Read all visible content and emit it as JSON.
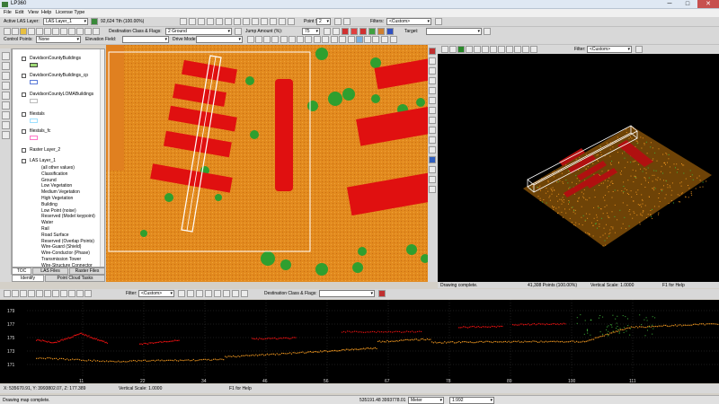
{
  "window": {
    "title": "LP360",
    "min": "─",
    "max": "□",
    "close": "✕"
  },
  "menu": [
    "File",
    "Edit",
    "View",
    "Help",
    "License Type"
  ],
  "toolbar1": {
    "active_las_label": "Active LAS Layer:",
    "active_las_value": "LAS Layer_1",
    "points_pct": "92,624 Tth (100.00%)",
    "point_size_label": "Point Size:",
    "point_size_value": "2",
    "filters_label": "Filters:",
    "filters_value": "<Custom>"
  },
  "toolbar2": {
    "dest_class_label": "Destination Class & Flags:",
    "dest_class_value": "2  Ground",
    "jump_amount_label": "Jump Amount (%):",
    "jump_amount_value": "75",
    "target_label": "Target:"
  },
  "toolbar3": {
    "control_points_label": "Control Points:",
    "control_points_value": "None",
    "elevation_field_label": "Elevation Field:",
    "drive_mode_label": "Drive Mode:"
  },
  "toc": {
    "layers": [
      {
        "label": "DavidsonCountyBuildings",
        "color": "#9fd977"
      },
      {
        "label": "DavidsonCountyBuildings_cp",
        "color": "#5a7ad8"
      },
      {
        "label": "DavidsonCountyLOMABuildings",
        "color": "#ffffff"
      },
      {
        "label": "filestals",
        "color": "#9de0ff"
      },
      {
        "label": "filestals_fc",
        "color": "#ff77c8"
      },
      {
        "label": "Raster Layer_2",
        "color": ""
      }
    ],
    "las_layer": "LAS Layer_1",
    "classes": [
      "(all other values)",
      "Classification",
      "Ground",
      "Low Vegetation",
      "Medium Vegetation",
      "High Vegetation",
      "Building",
      "Low Point (noise)",
      "Reserved (Model keypoint)",
      "Water",
      "Rail",
      "Road Surface",
      "Reserved (Overlap Points)",
      "Wire-Guard (Shield)",
      "Wire-Conductor (Phase)",
      "Transmission Tower",
      "Wire-Structure Connector"
    ],
    "tabs": [
      "TOC",
      "LAS Files",
      "Raster Files"
    ],
    "tabs2": [
      "Identify",
      "Point Cloud Tasks"
    ]
  },
  "view3d": {
    "filter_label": "Filter:",
    "filter_value": "<Custom>",
    "status_left": "Drawing complete.",
    "status_points": "41,308 Points (100.00%)",
    "status_scale": "Vertical Scale: 1.0000",
    "status_help": "F1 for Help"
  },
  "profile": {
    "filter_label": "Filter:",
    "filter_value": "<Custom>",
    "dest_label": "Destination Class & Flags:",
    "y_labels": [
      "179",
      "177",
      "175",
      "173",
      "171"
    ],
    "x_labels": [
      "11",
      "22",
      "34",
      "46",
      "56",
      "67",
      "78",
      "89",
      "100",
      "111"
    ],
    "status_coords": "X: 535670.91, Y: 3993802.07, Z: 177.389",
    "status_scale": "Vertical Scale: 1.0000",
    "status_help": "F1 for Help"
  },
  "bottom": {
    "status": "Drawing map complete.",
    "coords": "535191.48 3993778.01",
    "unit": "Meter",
    "scale": "1:992"
  },
  "colors": {
    "ground": "#e48a1c",
    "building": "#e01010",
    "vegetation": "#3fb43a"
  }
}
